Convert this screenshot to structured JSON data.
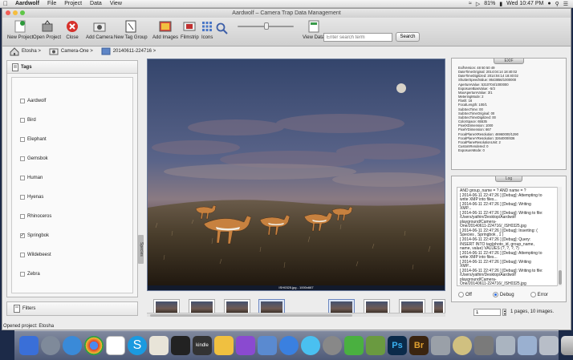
{
  "menubar": {
    "app": "Aardwolf",
    "items": [
      "File",
      "Project",
      "Data",
      "View"
    ],
    "status": {
      "battery": "81%",
      "clock": "Wed 10:47 PM"
    }
  },
  "window": {
    "title": "Aardwolf – Camera Trap Data Management"
  },
  "toolbar": {
    "new_project": "New Project",
    "open_project": "Open Project",
    "close": "Close",
    "add_camera": "Add Camera",
    "new_tag_group": "New Tag Group",
    "add_images": "Add Images",
    "filmstrip": "Filmstrip",
    "icons": "Icons",
    "view_data": "View Data",
    "search_placeholder": "Enter search term",
    "search_button": "Search"
  },
  "breadcrumb": {
    "project": "Etosha >",
    "camera": "Camera-One >",
    "folder": "20140611-224716 >"
  },
  "tags": {
    "header": "Tags",
    "tab_label": "Species",
    "items": [
      {
        "label": "Aardwolf",
        "checked": false
      },
      {
        "label": "Bird",
        "checked": false
      },
      {
        "label": "Elephant",
        "checked": false
      },
      {
        "label": "Gemsbok",
        "checked": false
      },
      {
        "label": "Human",
        "checked": false
      },
      {
        "label": "Hyenas",
        "checked": false
      },
      {
        "label": "Rhinoceros",
        "checked": false
      },
      {
        "label": "Springbok",
        "checked": true
      },
      {
        "label": "Wildebeest",
        "checked": false
      },
      {
        "label": "Zebra",
        "checked": false
      }
    ]
  },
  "filters": {
    "label": "Filters"
  },
  "image": {
    "caption": "ISH0325.jpg - 1000x667"
  },
  "exif": {
    "title": "EXIF",
    "lines": [
      "ExifVersion: 48 50 50 49",
      "DateTimeOriginal: 2014:04:14 18:40:02",
      "DateTimeDigitized: 2014:04:14 18:40:02",
      "ShutterSpeedValue: 8643856/1000000",
      "ApertureValue: 5310704/1000000",
      "ExposureBiasValue: -5/3",
      "MaxApertureValue: 3/1",
      "MeteringMode: 2",
      "Flash: 16",
      "FocalLength: 100/1",
      "SubSecTime: 00",
      "SubSecTimeOriginal: 00",
      "SubSecTimeDigitized: 00",
      "ColorSpace: 65535",
      "PixelXDimension: 1000",
      "PixelYDimension: 667",
      "FocalPlaneXResolution: 46960000/1290",
      "FocalPlaneYResolution: 3264000/836",
      "FocalPlaneResolutionUnit: 2",
      "CustomRendered: 0",
      "ExposureMode: 0"
    ]
  },
  "log": {
    "title": "Log",
    "text": "AND group_name = ? AND name = ?\n[ 2014-06-11 22:47:26 ] [Debug]: Attempting to\nwrite XMP into files...\n[ 2014-06-11 22:47:26 ] [Debug]: Writing\nXMP...\n[ 2014-06-11 22:47:26 ] [Debug]: Writing to file:\n/Users/yathin/Desktop/Aardwolf\nplayground/Camera-\nOne/20140611-224716/_ISH0325.jpg\n[ 2014-06-11 22:47:26 ] [Debug]: Inserting: (\nSpecies , Springbok , 1 )\n[ 2014-06-11 22:47:26 ] [Debug]: Query:\nINSERT INTO tag(photo_id, group_name,\nname, value) VALUES (?, ?, ?, ?)\n[ 2014-06-11 22:47:26 ] [Debug]: Attempting to\nwrite XMP into files...\n[ 2014-06-11 22:47:26 ] [Debug]: Writing\nXMP...\n[ 2014-06-11 22:47:26 ] [Debug]: Writing to file:\n/Users/yathin/Desktop/Aardwolf\nplayground/Camera-\nOne/20140611-224716/_ISH0325.jpg",
    "levels": [
      {
        "label": "Off",
        "selected": false
      },
      {
        "label": "Debug",
        "selected": true
      },
      {
        "label": "Error",
        "selected": false
      }
    ]
  },
  "pagination": {
    "page": "1",
    "label": "1 pages, 10 images."
  },
  "status": {
    "text": "Opened project: Etosha"
  },
  "dock": {
    "photoshop": "Ps",
    "bridge": "Br",
    "kindle": "kindle"
  },
  "colors": {
    "accent": "#2d6de0",
    "sky_top": "#3a4a70",
    "ground": "#3a2a18"
  }
}
